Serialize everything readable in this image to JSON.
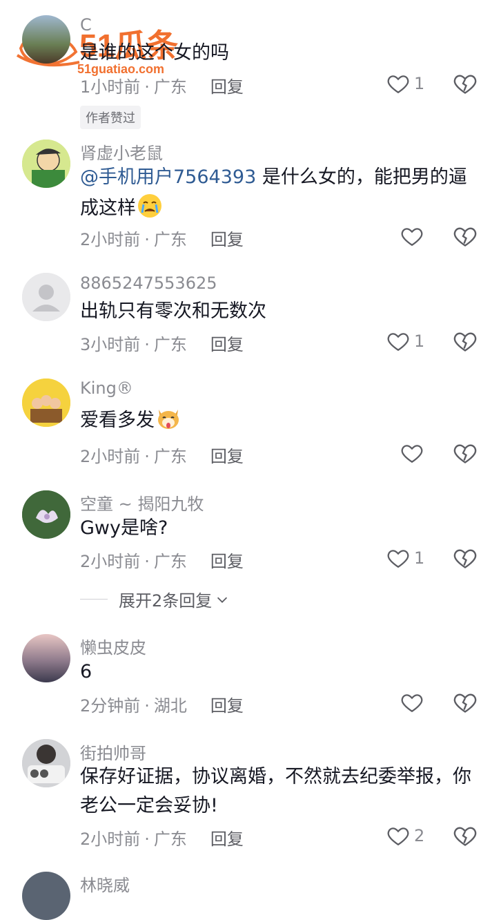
{
  "watermark": {
    "brand": "51瓜条",
    "url": "51guatiao.com"
  },
  "comments": [
    {
      "user": "C",
      "text": "是谁的这个女的吗",
      "time": "1小时前",
      "location": "广东",
      "reply": "回复",
      "likes": "1",
      "badge": "作者赞过"
    },
    {
      "user": "肾虚小老鼠",
      "mention": "@手机用户7564393",
      "text": " 是什么女的，能把男的逼成这样",
      "time": "2小时前",
      "location": "广东",
      "reply": "回复",
      "likes": ""
    },
    {
      "user": "8865247553625",
      "text": "出轨只有零次和无数次",
      "time": "3小时前",
      "location": "广东",
      "reply": "回复",
      "likes": "1"
    },
    {
      "user": "King®",
      "text": "爱看多发",
      "time": "2小时前",
      "location": "广东",
      "reply": "回复",
      "likes": ""
    },
    {
      "user": "空童 ~ 揭阳九牧",
      "text": "Gwy是啥?",
      "time": "2小时前",
      "location": "广东",
      "reply": "回复",
      "likes": "1"
    },
    {
      "user": "懒虫皮皮",
      "text": "6",
      "time": "2分钟前",
      "location": "湖北",
      "reply": "回复",
      "likes": ""
    },
    {
      "user": "街拍帅哥",
      "text": "保存好证据，协议离婚，不然就去纪委举报，你老公一定会妥协!",
      "time": "2小时前",
      "location": "广东",
      "reply": "回复",
      "likes": "2"
    },
    {
      "user": "林晓威"
    }
  ],
  "expand_label": "展开2条回复",
  "colors": {
    "mention": "#2f5b93",
    "meta": "#8a8b91",
    "watermark": "#f0641e"
  }
}
